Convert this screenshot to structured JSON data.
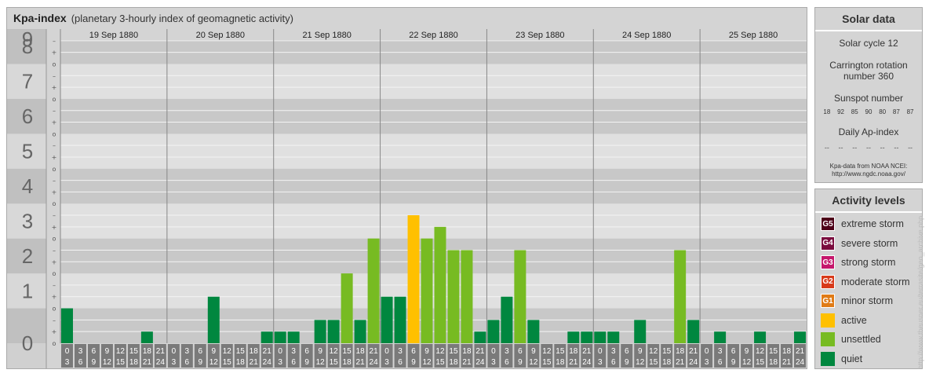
{
  "chart_data": {
    "type": "bar",
    "title": "Kpa-index",
    "subtitle": "(planetary 3-hourly index of geomagnetic activity)",
    "ylim": [
      0,
      9
    ],
    "y_ticks": [
      "0",
      "1",
      "2",
      "3",
      "4",
      "5",
      "6",
      "7",
      "8",
      "9"
    ],
    "minor_ticks": [
      "o",
      "+",
      "–"
    ],
    "days": [
      "19 Sep 1880",
      "20 Sep 1880",
      "21 Sep 1880",
      "22 Sep 1880",
      "23 Sep 1880",
      "24 Sep 1880",
      "25 Sep 1880"
    ],
    "interval_start": [
      "0",
      "3",
      "6",
      "9",
      "12",
      "15",
      "18",
      "21"
    ],
    "interval_end": [
      "3",
      "6",
      "9",
      "12",
      "15",
      "18",
      "21",
      "24"
    ],
    "values": [
      [
        1.0,
        0.0,
        0.0,
        0.0,
        0.0,
        0.0,
        0.333,
        0.0
      ],
      [
        0.0,
        0.0,
        0.0,
        1.333,
        0.0,
        0.0,
        0.0,
        0.333
      ],
      [
        0.333,
        0.333,
        0.0,
        0.667,
        0.667,
        2.0,
        0.667,
        3.0
      ],
      [
        1.333,
        1.333,
        3.667,
        3.0,
        3.333,
        2.667,
        2.667,
        0.333
      ],
      [
        0.667,
        1.333,
        2.667,
        0.667,
        0.0,
        0.0,
        0.333,
        0.333
      ],
      [
        0.333,
        0.333,
        0.0,
        0.667,
        0.0,
        0.0,
        2.667,
        0.667
      ],
      [
        0.0,
        0.333,
        0.0,
        0.0,
        0.333,
        0.0,
        0.0,
        0.333
      ]
    ],
    "grid": true
  },
  "colors": {
    "quiet": "#00873f",
    "unsettled": "#77bb22",
    "active": "#ffc000",
    "minor": "#e07b16",
    "moderate": "#d83a1a",
    "strong": "#c5186c",
    "severe": "#7a0c3e",
    "extreme": "#4d0018"
  },
  "solar": {
    "title": "Solar data",
    "cycle": "Solar cycle 12",
    "rotation_line1": "Carrington rotation",
    "rotation_line2": "number 360",
    "sunspot_title": "Sunspot number",
    "sunspots": [
      "18",
      "92",
      "85",
      "90",
      "80",
      "87",
      "87"
    ],
    "ap_title": "Daily Ap-index",
    "ap_values": [
      "--",
      "--",
      "--",
      "--",
      "--",
      "--",
      "--"
    ],
    "credit_line1": "Kpa-data from NOAA NCEI:",
    "credit_line2": "http://www.ngdc.noaa.gov/"
  },
  "activity": {
    "title": "Activity levels",
    "levels": [
      {
        "badge": "G5",
        "label": "extreme storm",
        "color": "#4d0018"
      },
      {
        "badge": "G4",
        "label": "severe storm",
        "color": "#7a0c3e"
      },
      {
        "badge": "G3",
        "label": "strong storm",
        "color": "#c5186c"
      },
      {
        "badge": "G2",
        "label": "moderate storm",
        "color": "#d83a1a"
      },
      {
        "badge": "G1",
        "label": "minor storm",
        "color": "#e07b16"
      },
      {
        "badge": "",
        "label": "active",
        "color": "#ffc000"
      },
      {
        "badge": "",
        "label": "unsettled",
        "color": "#77bb22"
      },
      {
        "badge": "",
        "label": "quiet",
        "color": "#00873f"
      }
    ]
  },
  "watermark": "http://www.theusner.eu/terrasite/geo_archive.php"
}
